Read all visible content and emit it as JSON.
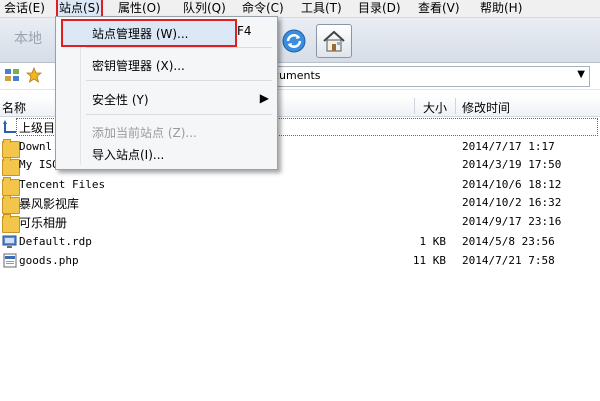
{
  "menubar": {
    "items": [
      {
        "label": "会话(E)"
      },
      {
        "label": "站点(S)"
      },
      {
        "label": "属性(O)"
      },
      {
        "label": "队列(Q)"
      },
      {
        "label": "命令(C)"
      },
      {
        "label": "工具(T)"
      },
      {
        "label": "目录(D)"
      },
      {
        "label": "查看(V)"
      },
      {
        "label": "帮助(H)"
      }
    ]
  },
  "toolbar": {
    "local_label": "本地"
  },
  "address": {
    "path_visible": "cuments"
  },
  "columns": {
    "name": "名称",
    "size": "大小",
    "modified": "修改时间"
  },
  "files": [
    {
      "name": "上级目",
      "size": "",
      "date": "",
      "icon": "up-arrow-icon"
    },
    {
      "name": "Downl",
      "size": "",
      "date": "2014/7/17 1:17",
      "icon": "folder-icon"
    },
    {
      "name": "My ISO Files",
      "size": "",
      "date": "2014/3/19 17:50",
      "icon": "folder-icon"
    },
    {
      "name": "Tencent Files",
      "size": "",
      "date": "2014/10/6 18:12",
      "icon": "folder-icon"
    },
    {
      "name": "暴风影视库",
      "size": "",
      "date": "2014/10/2 16:32",
      "icon": "folder-icon"
    },
    {
      "name": "可乐相册",
      "size": "",
      "date": "2014/9/17 23:16",
      "icon": "folder-icon"
    },
    {
      "name": "Default.rdp",
      "size": "1 KB",
      "date": "2014/5/8 23:56",
      "icon": "rdp-file-icon"
    },
    {
      "name": "goods.php",
      "size": "11 KB",
      "date": "2014/7/21 7:58",
      "icon": "php-file-icon"
    }
  ],
  "dropdown": {
    "site_manager": "站点管理器 (W)...",
    "site_manager_shortcut": "F4",
    "key_manager": "密钥管理器 (X)...",
    "security": "安全性 (Y)",
    "add_current_site": "添加当前站点 (Z)...",
    "import_site": "导入站点(I)..."
  },
  "colors": {
    "highlight_border": "#e02020",
    "folder": "#f3c64b"
  }
}
